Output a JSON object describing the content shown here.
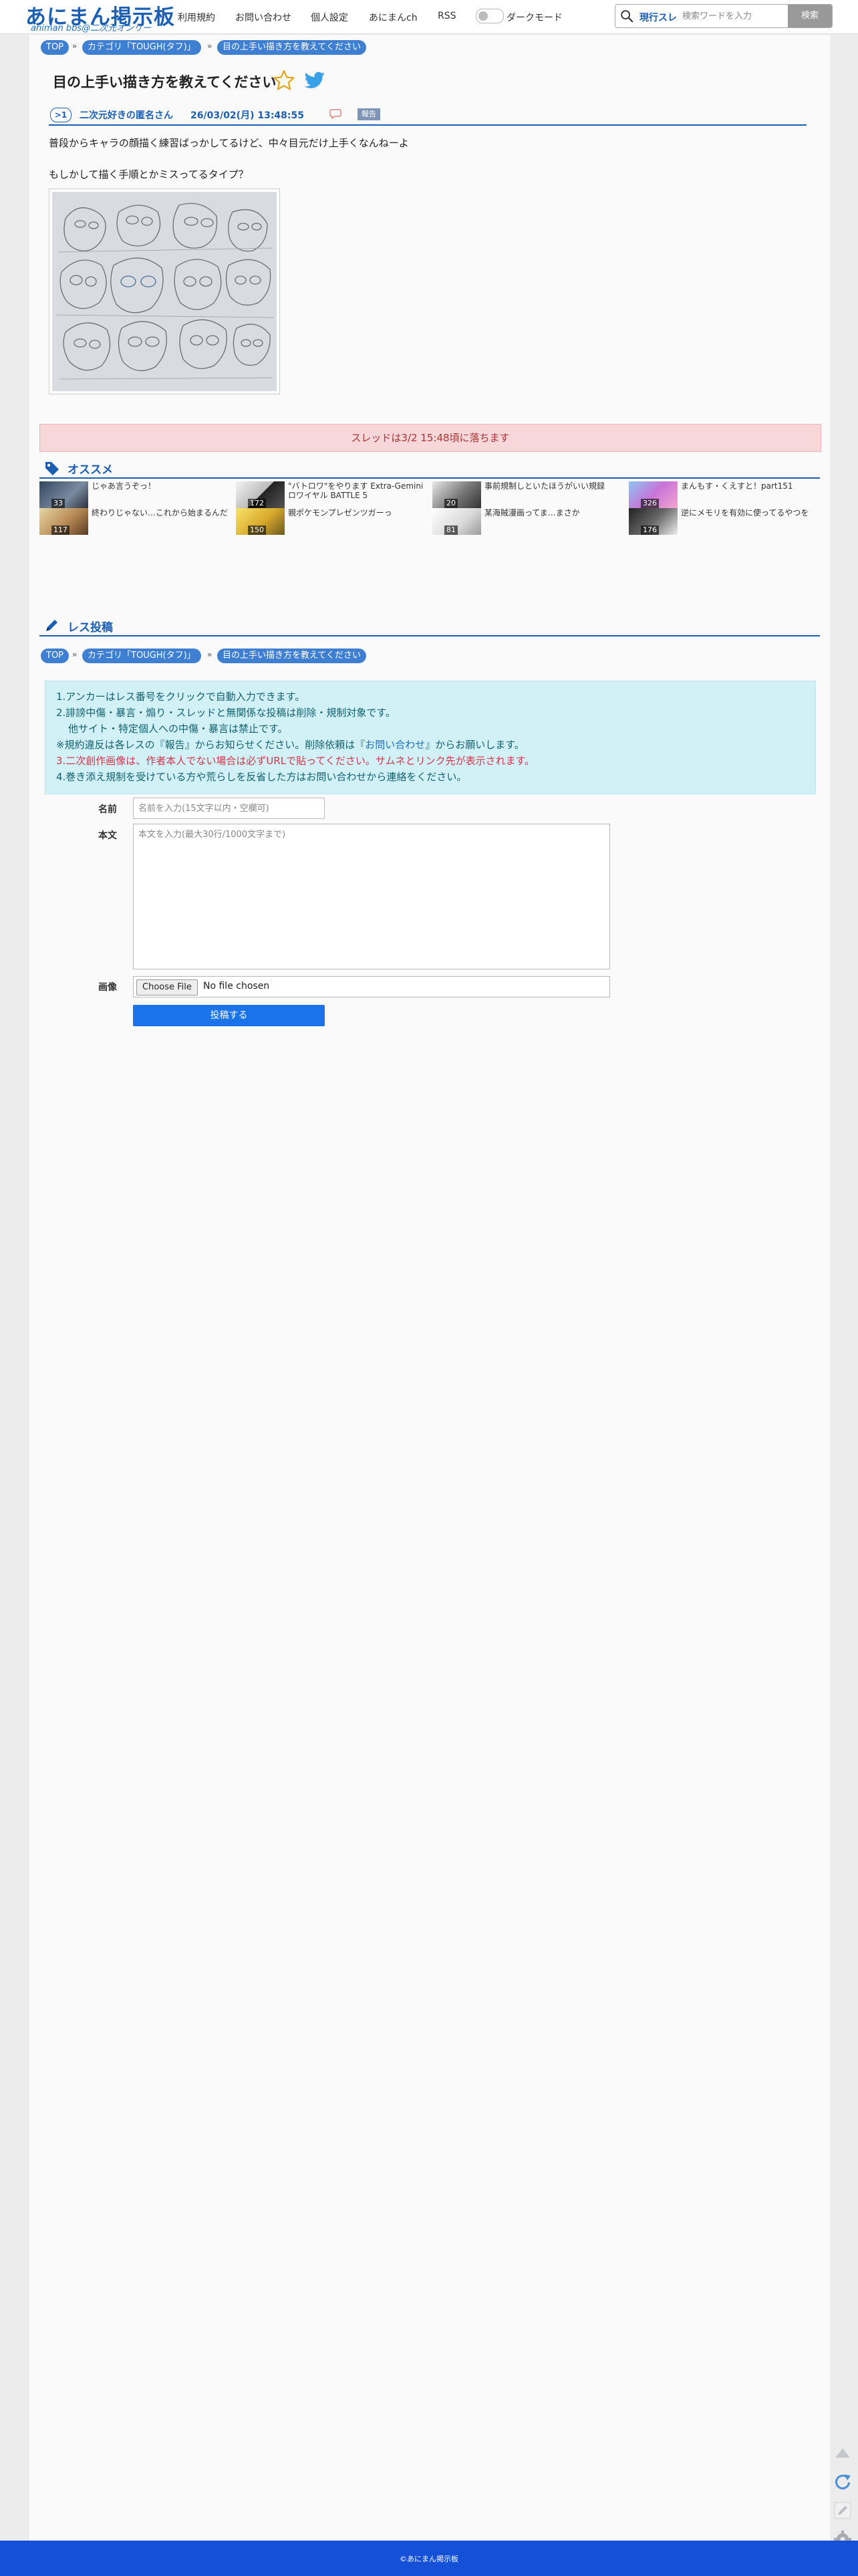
{
  "header": {
    "logo_main": "あにまん掲示板",
    "logo_sub": "animan bbs@二次元オンリー",
    "nav": [
      "利用規約",
      "お問い合わせ",
      "個人設定",
      "あにまんch",
      "RSS"
    ],
    "dark_mode_label": "ダークモード",
    "search_scope": "現行スレ",
    "search_placeholder": "検索ワードを入力",
    "search_button": "検索"
  },
  "breadcrumb": {
    "top": "TOP",
    "category": "カテゴリ「TOUGH(タフ)」",
    "thread": "目の上手い描き方を教えてください"
  },
  "thread": {
    "title": "目の上手い描き方を教えてください"
  },
  "post": {
    "number": ">1",
    "author": "二次元好きの匿名さん",
    "date": "26/03/02(月) 13:48:55",
    "report": "報告",
    "line1": "普段からキャラの顔描く練習ばっかしてるけど、中々目元だけ上手くなんねーよ",
    "line2": "もしかして描く手順とかミスってるタイプ？"
  },
  "notice": "スレッドは3/2 15:48頃に落ちます",
  "recommend": {
    "heading": "オススメ",
    "items": [
      {
        "title": "じゃあ言うぞっ！",
        "count": "33"
      },
      {
        "title": "\"バトロワ\"をやります Extra-Gemini ロワイヤル BATTLE 5",
        "count": "172"
      },
      {
        "title": "事前規制しといたほうがいい規録",
        "count": "20"
      },
      {
        "title": "まんもす・くえすと！part151",
        "count": "326"
      },
      {
        "title": "終わりじゃない…これから始まるんだ",
        "count": "117"
      },
      {
        "title": "親ポケモンプレゼンツガーっ",
        "count": "150"
      },
      {
        "title": "某海賊漫画ってま…まさか",
        "count": "81"
      },
      {
        "title": "逆にメモリを有効に使ってるやつを",
        "count": "176"
      }
    ]
  },
  "reply": {
    "heading": "レス投稿",
    "rules": {
      "r1": "1.アンカーはレス番号をクリックで自動入力できます。",
      "r2": "2.誹謗中傷・暴言・煽り・スレッドと無関係な投稿は削除・規制対象です。",
      "r2b": "他サイト・特定個人への中傷・暴言は禁止です。",
      "r3a": "※規約違反は各レスの『報告』からお知らせください。削除依頼は『",
      "r3link": "お問い合わせ",
      "r3b": "』からお願いします。",
      "r4a": "3.二次創作画像は、",
      "r4red": "作者本人でない場合は必ずURLで貼ってください。サムネとリンク先が表示されます。",
      "r5": "4.巻き添え規制を受けている方や荒らしを反省した方はお問い合わせから連絡をください。"
    },
    "name_label": "名前",
    "name_placeholder": "名前を入力(15文字以内・空欄可)",
    "body_label": "本文",
    "body_placeholder": "本文を入力(最大30行/1000文字まで)",
    "image_label": "画像",
    "file_button": "Choose File",
    "file_status": "No file chosen",
    "submit": "投稿する"
  },
  "footer": "©あにまん掲示板",
  "colors": {
    "brand": "#1b5fb5",
    "footer": "#1550d8",
    "notice_bg": "#f8d7da",
    "rules_bg": "#d1f1f7",
    "submit": "#1a73e8"
  },
  "icons": [
    "search-icon",
    "star-icon",
    "twitter-icon",
    "reply-icon",
    "tag-icon",
    "pencil-icon",
    "scroll-top-icon",
    "reload-icon",
    "edit-icon",
    "gear-icon"
  ]
}
